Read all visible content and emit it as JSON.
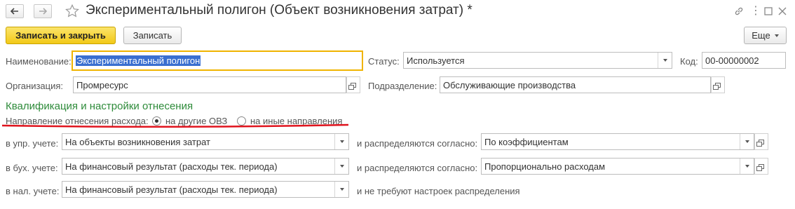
{
  "window": {
    "title": "Экспериментальный полигон (Объект возникновения затрат) *"
  },
  "toolbar": {
    "save_close_label": "Записать и закрыть",
    "save_label": "Записать",
    "more_label": "Еще"
  },
  "form": {
    "name_label": "Наименование:",
    "name_value": "Экспериментальный полигон",
    "status_label": "Статус:",
    "status_value": "Используется",
    "code_label": "Код:",
    "code_value": "00-00000002",
    "org_label": "Организация:",
    "org_value": "Промресурс",
    "division_label": "Подразделение:",
    "division_value": "Обслуживающие производства"
  },
  "qualification": {
    "section_title": "Квалификация и настройки отнесения",
    "direction_label": "Направление отнесения расхода:",
    "options": [
      "на другие ОВЗ",
      "на иные направления"
    ],
    "selected_option": "на другие ОВЗ",
    "mgmt_label": "в упр. учете:",
    "mgmt_value": "На объекты возникновения затрат",
    "mgmt_distr_label": "и распределяются согласно:",
    "mgmt_distr_value": "По коэффициентам",
    "acc_label": "в бух. учете:",
    "acc_value": "На финансовый результат (расходы тек. периода)",
    "acc_distr_label": "и распределяются согласно:",
    "acc_distr_value": "Пропорционально расходам",
    "tax_label": "в нал. учете:",
    "tax_value": "На финансовый результат (расходы тек. периода)",
    "tax_note": "и не требуют настроек распределения"
  },
  "colors": {
    "primary_button": "#f2c918",
    "section_title": "#2e8b3a",
    "annotation_underline": "#e0141e",
    "focus_border": "#f0b400",
    "selection": "#3a6fd0"
  }
}
